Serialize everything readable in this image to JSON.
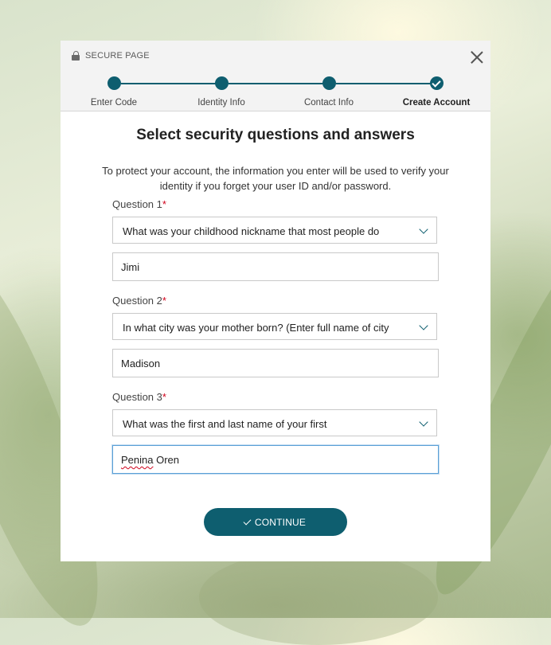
{
  "header": {
    "secure_label": "SECURE PAGE"
  },
  "steps": [
    {
      "label": "Enter Code",
      "done": false
    },
    {
      "label": "Identity Info",
      "done": false
    },
    {
      "label": "Contact Info",
      "done": false
    },
    {
      "label": "Create Account",
      "done": true,
      "active": true
    }
  ],
  "main": {
    "title": "Select security questions and answers",
    "intro_line1": "To protect your account, the information you enter will be used to verify your",
    "intro_line2": "identity if you forget your user ID and/or password.",
    "questions": [
      {
        "label": "Question 1",
        "required": "*",
        "selected": "What was your childhood nickname that most people do",
        "answer": "Jimi"
      },
      {
        "label": "Question 2",
        "required": "*",
        "selected": "In what city was your mother born? (Enter full name of city",
        "answer": "Madison"
      },
      {
        "label": "Question 3",
        "required": "*",
        "selected": "What was the first and last name of your first",
        "answer_first": "Penina",
        "answer_rest": " Oren"
      }
    ],
    "continue_label": "CONTINUE"
  },
  "colors": {
    "accent": "#0e5e6f",
    "required": "#d0021b",
    "focus": "#5a9fd6"
  },
  "icons": {
    "lock": "lock-icon",
    "close": "close-icon",
    "chevron": "chevron-down-icon",
    "check": "check-icon"
  }
}
